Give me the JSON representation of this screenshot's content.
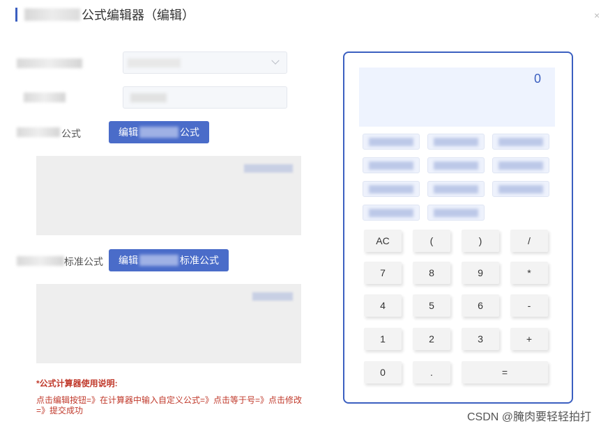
{
  "dialog": {
    "title": "公式编辑器（编辑）",
    "close_symbol": "×"
  },
  "form": {
    "formula_label_suffix": "公式",
    "edit_formula_prefix": "编辑",
    "edit_formula_suffix": "公式",
    "std_formula_label_suffix": "标准公式",
    "edit_std_formula_prefix": "编辑",
    "edit_std_formula_suffix": "标准公式"
  },
  "instructions": {
    "title": "*公式计算器使用说明:",
    "body": "点击编辑按钮=》在计算器中输入自定义公式=》点击等于号=》点击修改=》提交成功"
  },
  "calculator": {
    "display_value": "0",
    "keys": {
      "ac": "AC",
      "lparen": "(",
      "rparen": ")",
      "divide": "/",
      "k7": "7",
      "k8": "8",
      "k9": "9",
      "multiply": "*",
      "k4": "4",
      "k5": "5",
      "k6": "6",
      "minus": "-",
      "k1": "1",
      "k2": "2",
      "k3": "3",
      "plus": "+",
      "k0": "0",
      "dot": ".",
      "equals": "="
    }
  },
  "watermark": "CSDN @腌肉要轻轻拍打",
  "colors": {
    "accent": "#3b5fc0",
    "button": "#4a6cc9",
    "instruction_text": "#c0392b"
  }
}
